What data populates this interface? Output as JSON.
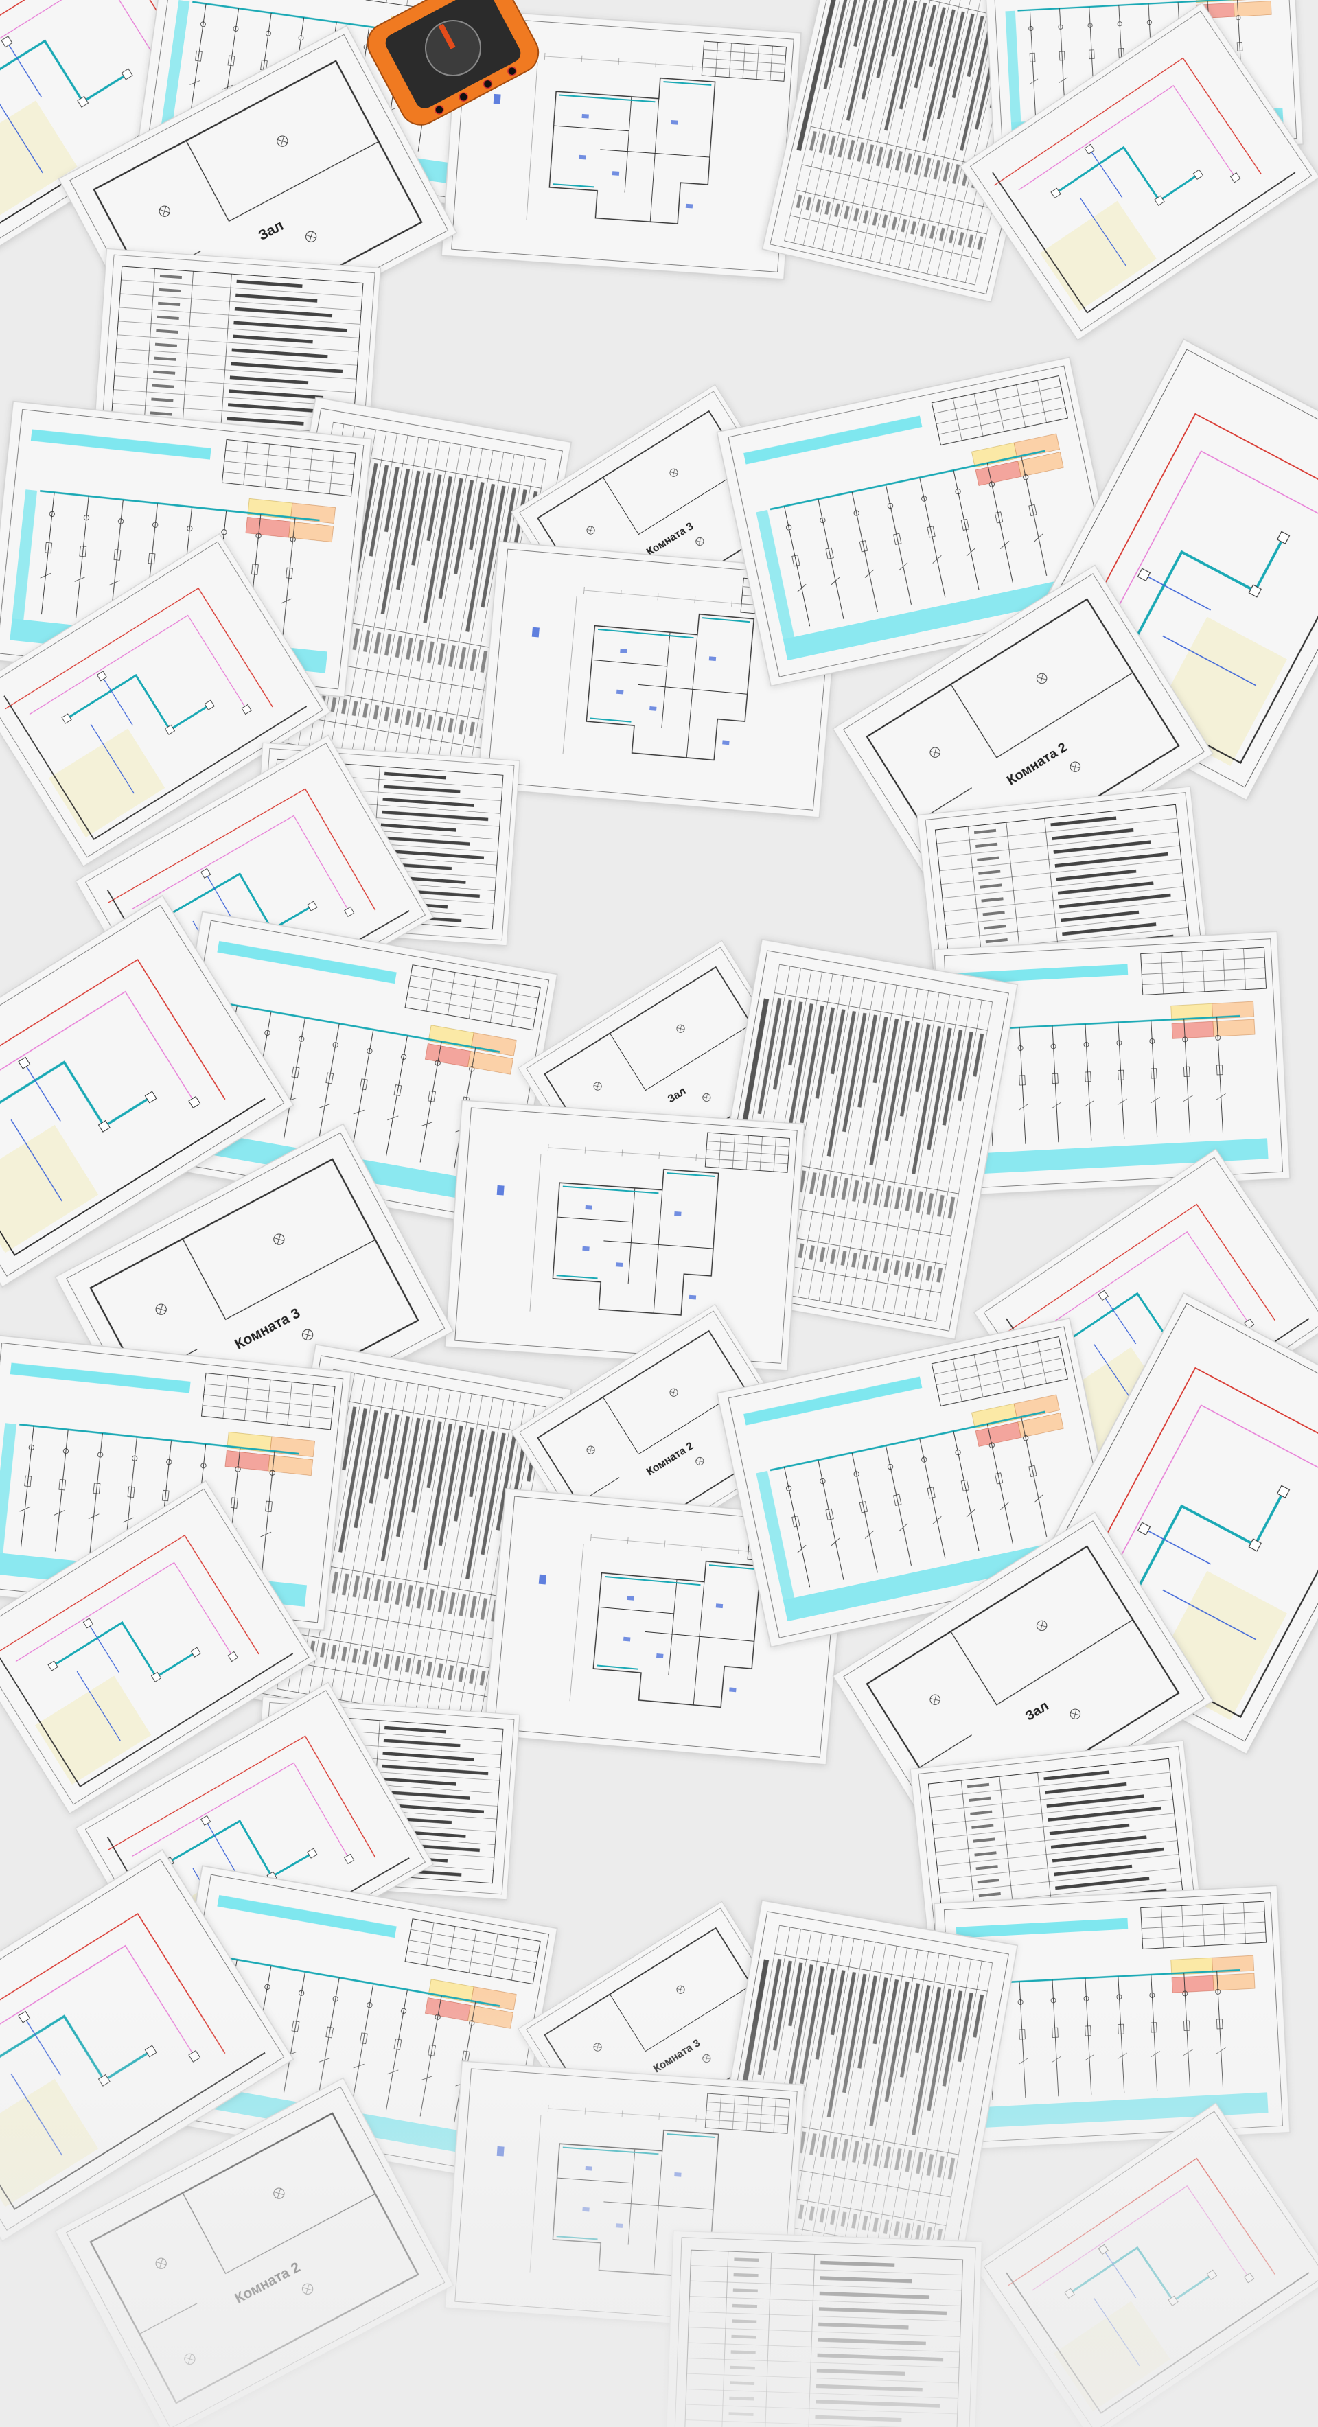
{
  "background_color": "#ececec",
  "palette": {
    "paper": "#f6f6f6",
    "line": "#333333",
    "cyan": "#7fe7ef",
    "cyan_line": "#1aa9b5",
    "orange_cell": "#fbd1a8",
    "yellow_cell": "#fbe9a6",
    "red_cell": "#f3a59d",
    "pink": "#e77bd6",
    "blue": "#3a62d8",
    "red": "#d8342c",
    "beige": "#f4f1d8",
    "multimeter": "#f07a21"
  },
  "sheet_types": [
    "single-line-diagram-sheet",
    "floor-plan-sheet",
    "specification-table-sheet",
    "room-plan-sheet",
    "routing-plan-sheet",
    "stamp-table-sheet"
  ],
  "props": [
    "multimeter"
  ],
  "room_labels": [
    "Зал",
    "Комната 3",
    "Комната 2"
  ]
}
